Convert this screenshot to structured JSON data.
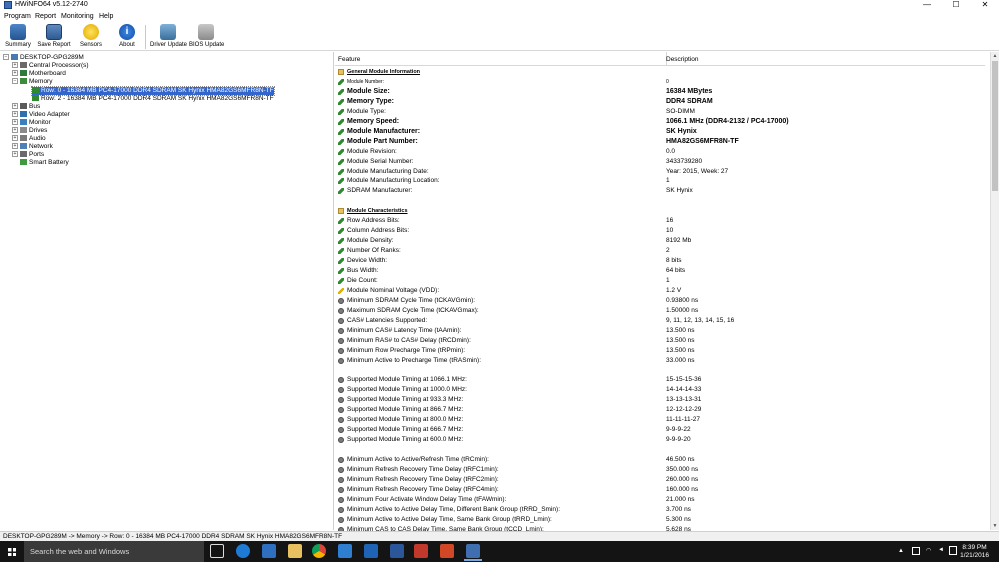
{
  "window": {
    "title": "HWiNFO64 v5.12-2740",
    "minimize": "—",
    "maximize": "☐",
    "close": "✕"
  },
  "menu": [
    "Program",
    "Report",
    "Monitoring",
    "Help"
  ],
  "toolbar": {
    "buttons": [
      {
        "label": "Summary",
        "icon": "summary-icon"
      },
      {
        "label": "Save Report",
        "icon": "save-icon"
      },
      {
        "label": "Sensors",
        "icon": "sensors-icon"
      },
      {
        "label": "About",
        "icon": "info-icon"
      },
      {
        "label": "Driver Update",
        "icon": "driver-update-icon"
      },
      {
        "label": "BIOS Update",
        "icon": "bios-update-icon"
      }
    ]
  },
  "tree": {
    "root": "DESKTOP-GPG289M",
    "items": [
      {
        "label": "Central Processor(s)",
        "expander": "+"
      },
      {
        "label": "Motherboard",
        "expander": "+"
      },
      {
        "label": "Memory",
        "expander": "−"
      },
      {
        "label": "Row: 0 - 16384 MB PC4-17000 DDR4 SDRAM SK Hynix HMA82GS6MFR8N-TF",
        "child": true,
        "selected": true
      },
      {
        "label": "Row: 2 - 16384 MB PC4-17000 DDR4 SDRAM SK Hynix HMA82GS6MFR8N-TF",
        "child": true
      },
      {
        "label": "Bus",
        "expander": "+"
      },
      {
        "label": "Video Adapter",
        "expander": "+"
      },
      {
        "label": "Monitor",
        "expander": "+"
      },
      {
        "label": "Drives",
        "expander": "+"
      },
      {
        "label": "Audio",
        "expander": "+"
      },
      {
        "label": "Network",
        "expander": "+"
      },
      {
        "label": "Ports",
        "expander": "+"
      },
      {
        "label": "Smart Battery",
        "expander": ""
      }
    ]
  },
  "details": {
    "col_feature": "Feature",
    "col_description": "Description",
    "rows": [
      {
        "type": "section",
        "icon": "folder",
        "feature": "General Module Information",
        "desc": ""
      },
      {
        "type": "small",
        "icon": "pencil",
        "feature": "Module Number:",
        "desc": "0"
      },
      {
        "type": "bold",
        "icon": "pencil",
        "feature": "Module Size:",
        "desc": "16384 MBytes"
      },
      {
        "type": "bold",
        "icon": "pencil",
        "feature": "Memory Type:",
        "desc": "DDR4 SDRAM"
      },
      {
        "type": "normal",
        "icon": "pencil",
        "feature": "Module Type:",
        "desc": "SO-DIMM"
      },
      {
        "type": "bold",
        "icon": "pencil",
        "feature": "Memory Speed:",
        "desc": "1066.1 MHz (DDR4-2132 / PC4-17000)"
      },
      {
        "type": "bold",
        "icon": "pencil",
        "feature": "Module Manufacturer:",
        "desc": "SK Hynix"
      },
      {
        "type": "bold",
        "icon": "pencil",
        "feature": "Module Part Number:",
        "desc": "HMA82GS6MFR8N-TF"
      },
      {
        "type": "normal",
        "icon": "pencil",
        "feature": "Module Revision:",
        "desc": "0.0"
      },
      {
        "type": "normal",
        "icon": "pencil",
        "feature": "Module Serial Number:",
        "desc": "3433739280"
      },
      {
        "type": "normal",
        "icon": "pencil",
        "feature": "Module Manufacturing Date:",
        "desc": "Year: 2015, Week: 27"
      },
      {
        "type": "normal",
        "icon": "pencil",
        "feature": "Module Manufacturing Location:",
        "desc": "1"
      },
      {
        "type": "normal",
        "icon": "pencil",
        "feature": "SDRAM Manufacturer:",
        "desc": "SK Hynix"
      },
      {
        "type": "blank",
        "icon": "",
        "feature": "",
        "desc": ""
      },
      {
        "type": "section",
        "icon": "folder",
        "feature": "Module Characteristics",
        "desc": ""
      },
      {
        "type": "normal",
        "icon": "pencil",
        "feature": "Row Address Bits:",
        "desc": "16"
      },
      {
        "type": "normal",
        "icon": "pencil",
        "feature": "Column Address Bits:",
        "desc": "10"
      },
      {
        "type": "normal",
        "icon": "pencil",
        "feature": "Module Density:",
        "desc": "8192 Mb"
      },
      {
        "type": "normal",
        "icon": "pencil",
        "feature": "Number Of Ranks:",
        "desc": "2"
      },
      {
        "type": "normal",
        "icon": "pencil",
        "feature": "Device Width:",
        "desc": "8 bits"
      },
      {
        "type": "normal",
        "icon": "pencil",
        "feature": "Bus Width:",
        "desc": "64 bits"
      },
      {
        "type": "normal",
        "icon": "pencil",
        "feature": "Die Count:",
        "desc": "1"
      },
      {
        "type": "normal",
        "icon": "bolt",
        "feature": "Module Nominal Voltage (VDD):",
        "desc": "1.2 V"
      },
      {
        "type": "normal",
        "icon": "gear",
        "feature": "Minimum SDRAM Cycle Time (tCKAVGmin):",
        "desc": "0.93800 ns"
      },
      {
        "type": "normal",
        "icon": "gear",
        "feature": "Maximum SDRAM Cycle Time (tCKAVGmax):",
        "desc": "1.50000 ns"
      },
      {
        "type": "normal",
        "icon": "gear",
        "feature": "CAS# Latencies Supported:",
        "desc": "9, 11, 12, 13, 14, 15, 16"
      },
      {
        "type": "normal",
        "icon": "gear",
        "feature": "Minimum CAS# Latency Time (tAAmin):",
        "desc": "13.500 ns"
      },
      {
        "type": "normal",
        "icon": "gear",
        "feature": "Minimum RAS# to CAS# Delay (tRCDmin):",
        "desc": "13.500 ns"
      },
      {
        "type": "normal",
        "icon": "gear",
        "feature": "Minimum Row Precharge Time (tRPmin):",
        "desc": "13.500 ns"
      },
      {
        "type": "normal",
        "icon": "gear",
        "feature": "Minimum Active to Precharge Time (tRASmin):",
        "desc": "33.000 ns"
      },
      {
        "type": "blank",
        "icon": "",
        "feature": "",
        "desc": ""
      },
      {
        "type": "normal",
        "icon": "gear",
        "feature": "Supported Module Timing at 1066.1 MHz:",
        "desc": "15-15-15-36"
      },
      {
        "type": "normal",
        "icon": "gear",
        "feature": "Supported Module Timing at 1000.0 MHz:",
        "desc": "14-14-14-33"
      },
      {
        "type": "normal",
        "icon": "gear",
        "feature": "Supported Module Timing at 933.3 MHz:",
        "desc": "13-13-13-31"
      },
      {
        "type": "normal",
        "icon": "gear",
        "feature": "Supported Module Timing at 866.7 MHz:",
        "desc": "12-12-12-29"
      },
      {
        "type": "normal",
        "icon": "gear",
        "feature": "Supported Module Timing at 800.0 MHz:",
        "desc": "11-11-11-27"
      },
      {
        "type": "normal",
        "icon": "gear",
        "feature": "Supported Module Timing at 666.7 MHz:",
        "desc": "9-9-9-22"
      },
      {
        "type": "normal",
        "icon": "gear",
        "feature": "Supported Module Timing at 600.0 MHz:",
        "desc": "9-9-9-20"
      },
      {
        "type": "blank",
        "icon": "",
        "feature": "",
        "desc": ""
      },
      {
        "type": "normal",
        "icon": "gear",
        "feature": "Minimum Active to Active/Refresh Time (tRCmin):",
        "desc": "46.500 ns"
      },
      {
        "type": "normal",
        "icon": "gear",
        "feature": "Minimum Refresh Recovery Time Delay (tRFC1min):",
        "desc": "350.000 ns"
      },
      {
        "type": "normal",
        "icon": "gear",
        "feature": "Minimum Refresh Recovery Time Delay (tRFC2min):",
        "desc": "260.000 ns"
      },
      {
        "type": "normal",
        "icon": "gear",
        "feature": "Minimum Refresh Recovery Time Delay (tRFC4min):",
        "desc": "160.000 ns"
      },
      {
        "type": "normal",
        "icon": "gear",
        "feature": "Minimum Four Activate Window Delay Time (tFAWmin):",
        "desc": "21.000 ns"
      },
      {
        "type": "normal",
        "icon": "gear",
        "feature": "Minimum Active to Active Delay Time, Different Bank Group (tRRD_Smin):",
        "desc": "3.700 ns"
      },
      {
        "type": "normal",
        "icon": "gear",
        "feature": "Minimum Active to Active Delay Time, Same Bank Group (tRRD_Lmin):",
        "desc": "5.300 ns"
      },
      {
        "type": "normal",
        "icon": "gear",
        "feature": "Minimum CAS to CAS Delay Time, Same Bank Group (tCCD_Lmin):",
        "desc": "5.628 ns"
      }
    ]
  },
  "statusbar": {
    "text": "DESKTOP-GPG289M -> Memory -> Row: 0 - 16384 MB PC4-17000 DDR4 SDRAM SK Hynix HMA82GS6MFR8N-TF"
  },
  "taskbar": {
    "search_placeholder": "Search the web and Windows",
    "apps": [
      "task-view",
      "edge",
      "store",
      "file-explorer",
      "chrome",
      "app-blue",
      "outlook",
      "word",
      "app-red",
      "powerpoint",
      "hwinfo"
    ],
    "time": "8:39 PM",
    "date": "1/21/2016"
  },
  "colors": {
    "selection": "#3366cc",
    "taskbar": "#141414",
    "accent": "#7aa7e0"
  }
}
